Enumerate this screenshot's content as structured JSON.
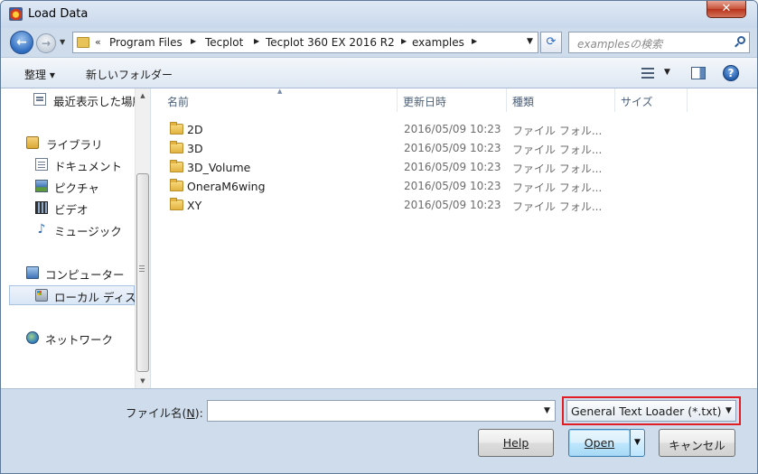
{
  "window": {
    "title": "Load Data",
    "close_label": "✕"
  },
  "address": {
    "overflow_label": "«",
    "crumbs": [
      "Program Files",
      "Tecplot",
      "Tecplot 360 EX 2016 R2",
      "examples"
    ],
    "search_placeholder": "examplesの検索"
  },
  "toolbar": {
    "organize_label": "整理 ▾",
    "new_folder_label": "新しいフォルダー",
    "help_label": "?"
  },
  "nav": {
    "items": [
      {
        "label": "最近表示した場所",
        "icon": "recent-places-icon"
      },
      {
        "label": "ライブラリ",
        "icon": "library-icon"
      },
      {
        "label": "ドキュメント",
        "icon": "documents-icon"
      },
      {
        "label": "ピクチャ",
        "icon": "pictures-icon"
      },
      {
        "label": "ビデオ",
        "icon": "videos-icon"
      },
      {
        "label": "ミュージック",
        "icon": "music-icon"
      },
      {
        "label": "コンピューター",
        "icon": "computer-icon"
      },
      {
        "label": "ローカル ディスク",
        "icon": "local-disk-icon"
      },
      {
        "label": "ネットワーク",
        "icon": "network-icon"
      }
    ],
    "selected": "ローカル ディスク"
  },
  "file_list": {
    "columns": [
      "名前",
      "更新日時",
      "種類",
      "サイズ"
    ],
    "rows": [
      {
        "name": "2D",
        "modified": "2016/05/09 10:23",
        "type": "ファイル フォル..."
      },
      {
        "name": "3D",
        "modified": "2016/05/09 10:23",
        "type": "ファイル フォル..."
      },
      {
        "name": "3D_Volume",
        "modified": "2016/05/09 10:23",
        "type": "ファイル フォル..."
      },
      {
        "name": "OneraM6wing",
        "modified": "2016/05/09 10:23",
        "type": "ファイル フォル..."
      },
      {
        "name": "XY",
        "modified": "2016/05/09 10:23",
        "type": "ファイル フォル..."
      }
    ]
  },
  "footer": {
    "filename_label_pre": "ファイル名(",
    "filename_label_key": "N",
    "filename_label_post": "):",
    "filename_value": "",
    "filter_value": "General Text Loader (*.txt)",
    "help_button": "Help",
    "open_button": "Open",
    "cancel_button": "キャンセル"
  },
  "colors": {
    "highlight_border": "#e21d24",
    "window_frame": "#cfdcec"
  }
}
